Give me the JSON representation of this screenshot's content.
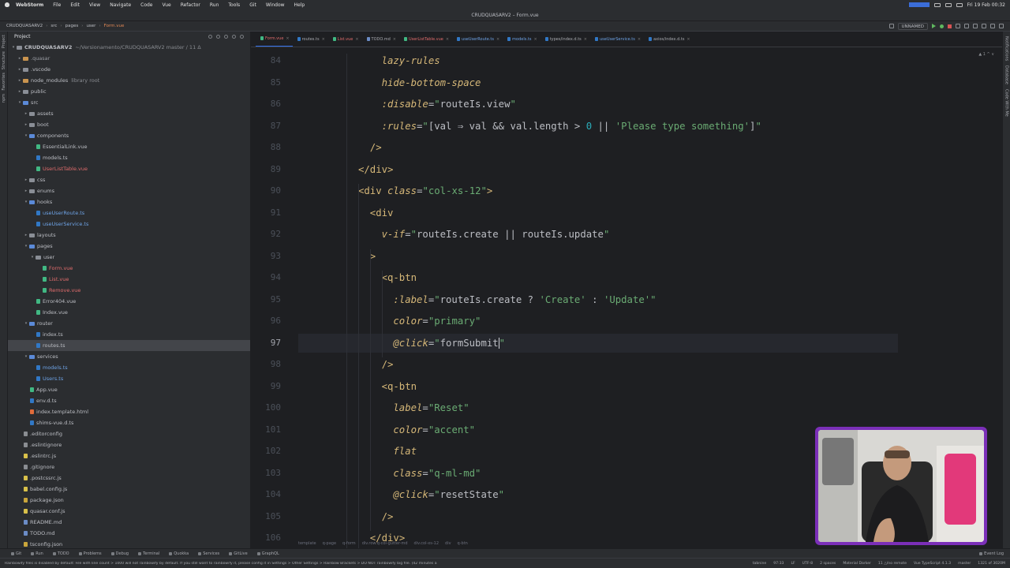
{
  "menubar": {
    "app_name": "WebStorm",
    "items": [
      "File",
      "Edit",
      "View",
      "Navigate",
      "Code",
      "Vue",
      "Refactor",
      "Run",
      "Tools",
      "Git",
      "Window",
      "Help"
    ],
    "clock": "Fri 19 Feb 00:32"
  },
  "window": {
    "title": "CRUDQUASARV2 – Form.vue"
  },
  "navbar": {
    "crumbs": [
      "CRUDQUASARV2",
      "src",
      "pages",
      "user",
      "Form.vue"
    ],
    "run_config": "UNNAMED"
  },
  "left_strip": {
    "tabs": [
      "Project",
      "Structure",
      "Favorites",
      "npm"
    ]
  },
  "project_panel": {
    "title": "Project",
    "tree": [
      {
        "depth": 0,
        "kind": "folder",
        "open": true,
        "label": "CRUDQUASARV2",
        "extra": "~/Versionamento/CRUDQUASARV2 master / 11 Δ",
        "bold": true
      },
      {
        "depth": 1,
        "kind": "folder",
        "color": "orange",
        "label": ".quasar",
        "style": "dim"
      },
      {
        "depth": 1,
        "kind": "folder",
        "label": ".vscode"
      },
      {
        "depth": 1,
        "kind": "folder",
        "color": "orange",
        "label": "node_modules",
        "extra": "library root"
      },
      {
        "depth": 1,
        "kind": "folder",
        "label": "public"
      },
      {
        "depth": 1,
        "kind": "folder",
        "open": true,
        "label": "src"
      },
      {
        "depth": 2,
        "kind": "folder",
        "label": "assets"
      },
      {
        "depth": 2,
        "kind": "folder",
        "label": "boot"
      },
      {
        "depth": 2,
        "kind": "folder",
        "open": true,
        "label": "components"
      },
      {
        "depth": 3,
        "kind": "file",
        "ftype": "vue",
        "label": "EssentialLink.vue"
      },
      {
        "depth": 3,
        "kind": "file",
        "ftype": "ts",
        "label": "models.ts"
      },
      {
        "depth": 3,
        "kind": "file",
        "ftype": "vue",
        "label": "UserListTable.vue",
        "style": "red"
      },
      {
        "depth": 2,
        "kind": "folder",
        "label": "css"
      },
      {
        "depth": 2,
        "kind": "folder",
        "label": "enums"
      },
      {
        "depth": 2,
        "kind": "folder",
        "open": true,
        "label": "hooks"
      },
      {
        "depth": 3,
        "kind": "file",
        "ftype": "ts",
        "label": "useUserRoute.ts",
        "style": "blue"
      },
      {
        "depth": 3,
        "kind": "file",
        "ftype": "ts",
        "label": "useUserService.ts",
        "style": "blue"
      },
      {
        "depth": 2,
        "kind": "folder",
        "label": "layouts"
      },
      {
        "depth": 2,
        "kind": "folder",
        "open": true,
        "label": "pages"
      },
      {
        "depth": 3,
        "kind": "folder",
        "open": true,
        "label": "user"
      },
      {
        "depth": 4,
        "kind": "file",
        "ftype": "vue",
        "label": "Form.vue",
        "style": "red"
      },
      {
        "depth": 4,
        "kind": "file",
        "ftype": "vue",
        "label": "List.vue",
        "style": "red"
      },
      {
        "depth": 4,
        "kind": "file",
        "ftype": "vue",
        "label": "Remove.vue",
        "style": "red"
      },
      {
        "depth": 3,
        "kind": "file",
        "ftype": "vue",
        "label": "Error404.vue"
      },
      {
        "depth": 3,
        "kind": "file",
        "ftype": "vue",
        "label": "Index.vue"
      },
      {
        "depth": 2,
        "kind": "folder",
        "open": true,
        "label": "router"
      },
      {
        "depth": 3,
        "kind": "file",
        "ftype": "ts",
        "label": "index.ts"
      },
      {
        "depth": 3,
        "kind": "file",
        "ftype": "ts",
        "label": "routes.ts",
        "selected": true
      },
      {
        "depth": 2,
        "kind": "folder",
        "open": true,
        "label": "services"
      },
      {
        "depth": 3,
        "kind": "file",
        "ftype": "ts",
        "label": "models.ts",
        "style": "blue"
      },
      {
        "depth": 3,
        "kind": "file",
        "ftype": "ts",
        "label": "Users.ts",
        "style": "blue"
      },
      {
        "depth": 2,
        "kind": "file",
        "ftype": "vue",
        "label": "App.vue"
      },
      {
        "depth": 2,
        "kind": "file",
        "ftype": "ts",
        "label": "env.d.ts"
      },
      {
        "depth": 2,
        "kind": "file",
        "ftype": "html",
        "label": "index.template.html"
      },
      {
        "depth": 2,
        "kind": "file",
        "ftype": "ts",
        "label": "shims-vue.d.ts"
      },
      {
        "depth": 1,
        "kind": "file",
        "ftype": "cfg",
        "label": ".editorconfig"
      },
      {
        "depth": 1,
        "kind": "file",
        "ftype": "cfg",
        "label": ".eslintignore"
      },
      {
        "depth": 1,
        "kind": "file",
        "ftype": "js",
        "label": ".eslintrc.js"
      },
      {
        "depth": 1,
        "kind": "file",
        "ftype": "cfg",
        "label": ".gitignore"
      },
      {
        "depth": 1,
        "kind": "file",
        "ftype": "js",
        "label": ".postcssrc.js"
      },
      {
        "depth": 1,
        "kind": "file",
        "ftype": "js",
        "label": "babel.config.js"
      },
      {
        "depth": 1,
        "kind": "file",
        "ftype": "json",
        "label": "package.json"
      },
      {
        "depth": 1,
        "kind": "file",
        "ftype": "js",
        "label": "quasar.conf.js"
      },
      {
        "depth": 1,
        "kind": "file",
        "ftype": "md",
        "label": "README.md"
      },
      {
        "depth": 1,
        "kind": "file",
        "ftype": "md",
        "label": "TODO.md"
      },
      {
        "depth": 1,
        "kind": "file",
        "ftype": "json",
        "label": "tsconfig.json"
      }
    ]
  },
  "editor": {
    "tabs": [
      {
        "label": "Form.vue",
        "ftype": "vue",
        "active": true,
        "style": "red"
      },
      {
        "label": "routes.ts",
        "ftype": "ts"
      },
      {
        "label": "List.vue",
        "ftype": "vue",
        "style": "red"
      },
      {
        "label": "TODO.md",
        "ftype": "md"
      },
      {
        "label": "UserListTable.vue",
        "ftype": "vue",
        "style": "red"
      },
      {
        "label": "useUserRoute.ts",
        "ftype": "ts",
        "style": "blue"
      },
      {
        "label": "models.ts",
        "ftype": "ts",
        "style": "blue"
      },
      {
        "label": "types/index.d.ts",
        "ftype": "ts"
      },
      {
        "label": "useUserService.ts",
        "ftype": "ts",
        "style": "blue"
      },
      {
        "label": "axios/index.d.ts",
        "ftype": "ts"
      }
    ],
    "inspection_badge": "▲ 1 ^ ∨",
    "current_line": 97,
    "lines": [
      {
        "n": 84,
        "indent": 7,
        "tokens": [
          [
            "attr-y",
            "lazy-rules"
          ]
        ]
      },
      {
        "n": 85,
        "indent": 7,
        "tokens": [
          [
            "attr-y",
            "hide-bottom-space"
          ]
        ]
      },
      {
        "n": 86,
        "indent": 7,
        "tokens": [
          [
            "attr-y",
            ":disable"
          ],
          [
            "punc",
            "="
          ],
          [
            "str",
            "\""
          ],
          [
            "plain",
            "routeIs.view"
          ],
          [
            "str",
            "\""
          ]
        ]
      },
      {
        "n": 87,
        "indent": 7,
        "tokens": [
          [
            "attr-y",
            ":rules"
          ],
          [
            "punc",
            "="
          ],
          [
            "str",
            "\""
          ],
          [
            "plain",
            "[val ⇒ val && val.length > "
          ],
          [
            "num",
            "0"
          ],
          [
            "plain",
            " || "
          ],
          [
            "str",
            "'Please type something'"
          ],
          [
            "plain",
            "]"
          ],
          [
            "str",
            "\""
          ]
        ]
      },
      {
        "n": 88,
        "indent": 6,
        "tokens": [
          [
            "tag",
            "/>"
          ]
        ]
      },
      {
        "n": 89,
        "indent": 5,
        "tokens": [
          [
            "tag",
            "</div>"
          ]
        ]
      },
      {
        "n": 90,
        "indent": 5,
        "tokens": [
          [
            "tag",
            "<div "
          ],
          [
            "attr",
            "class"
          ],
          [
            "punc",
            "="
          ],
          [
            "str",
            "\"col-xs-12\""
          ],
          [
            "tag",
            ">"
          ]
        ]
      },
      {
        "n": 91,
        "indent": 6,
        "tokens": [
          [
            "tag",
            "<div"
          ]
        ]
      },
      {
        "n": 92,
        "indent": 7,
        "tokens": [
          [
            "attr-y",
            "v-if"
          ],
          [
            "punc",
            "="
          ],
          [
            "str",
            "\""
          ],
          [
            "plain",
            "routeIs.create || routeIs.update"
          ],
          [
            "str",
            "\""
          ]
        ]
      },
      {
        "n": 93,
        "indent": 6,
        "tokens": [
          [
            "tag",
            ">"
          ]
        ]
      },
      {
        "n": 94,
        "indent": 7,
        "tokens": [
          [
            "tag",
            "<q-btn"
          ]
        ]
      },
      {
        "n": 95,
        "indent": 8,
        "tokens": [
          [
            "attr-y",
            ":label"
          ],
          [
            "punc",
            "="
          ],
          [
            "str",
            "\""
          ],
          [
            "plain",
            "routeIs.create ? "
          ],
          [
            "str",
            "'Create'"
          ],
          [
            "plain",
            " : "
          ],
          [
            "str",
            "'Update'"
          ],
          [
            "str",
            "\""
          ]
        ]
      },
      {
        "n": 96,
        "indent": 8,
        "tokens": [
          [
            "attr-y",
            "color"
          ],
          [
            "punc",
            "="
          ],
          [
            "str",
            "\"primary\""
          ]
        ]
      },
      {
        "n": 97,
        "indent": 8,
        "tokens": [
          [
            "attr-y",
            "@click"
          ],
          [
            "punc",
            "="
          ],
          [
            "str",
            "\""
          ],
          [
            "plain",
            "formSubmit"
          ],
          [
            "caret",
            ""
          ],
          [
            "str",
            "\""
          ]
        ]
      },
      {
        "n": 98,
        "indent": 7,
        "tokens": [
          [
            "tag",
            "/>"
          ]
        ]
      },
      {
        "n": 99,
        "indent": 7,
        "tokens": [
          [
            "tag",
            "<q-btn"
          ]
        ]
      },
      {
        "n": 100,
        "indent": 8,
        "tokens": [
          [
            "attr-y",
            "label"
          ],
          [
            "punc",
            "="
          ],
          [
            "str",
            "\"Reset\""
          ]
        ]
      },
      {
        "n": 101,
        "indent": 8,
        "tokens": [
          [
            "attr-y",
            "color"
          ],
          [
            "punc",
            "="
          ],
          [
            "str",
            "\"accent\""
          ]
        ]
      },
      {
        "n": 102,
        "indent": 8,
        "tokens": [
          [
            "attr-y",
            "flat"
          ]
        ]
      },
      {
        "n": 103,
        "indent": 8,
        "tokens": [
          [
            "attr-y",
            "class"
          ],
          [
            "punc",
            "="
          ],
          [
            "str",
            "\"q-ml-md\""
          ]
        ]
      },
      {
        "n": 104,
        "indent": 8,
        "tokens": [
          [
            "attr-y",
            "@click"
          ],
          [
            "punc",
            "="
          ],
          [
            "str",
            "\""
          ],
          [
            "plain",
            "resetState"
          ],
          [
            "str",
            "\""
          ]
        ]
      },
      {
        "n": 105,
        "indent": 7,
        "tokens": [
          [
            "tag",
            "/>"
          ]
        ]
      },
      {
        "n": 106,
        "indent": 6,
        "tokens": [
          [
            "tag",
            "</div>"
          ]
        ]
      }
    ],
    "bottom_breadcrumbs": [
      "template",
      "q-page",
      "q-form",
      "div.row.q-col-gutter-md",
      "div.col-xs-12",
      "div",
      "q-btn"
    ]
  },
  "right_strip": {
    "tabs": [
      "Notifications",
      "Database",
      "Code With Me"
    ]
  },
  "toolwindows": {
    "items": [
      "Git",
      "Run",
      "TODO",
      "Problems",
      "Debug",
      "Terminal",
      "Quokka",
      "Services",
      "GitLive",
      "GraphQL"
    ],
    "event_log": "Event Log"
  },
  "statusbar": {
    "message": "Rainbowify files is disabled by default: File with line count > 1000 will not rainbowify by default. If you still want to rainbowify it, please config it in Settings > Other Settings > Rainbow Brackets > DO NOT rainbowify big file. (42 minutes a",
    "right": [
      "tabnine",
      "97:33",
      "LF",
      "UTF-8",
      "2 spaces",
      "Material Darker",
      "11 △/no remote",
      "Vue TypeScript 4.1.3",
      "master",
      "1321 of 3020M"
    ]
  },
  "webcam": {
    "frame_color": "#7b2fb8"
  },
  "colors": {
    "accent": "#3574f0",
    "string": "#6aab73",
    "attribute": "#d5b778",
    "background": "#1e1f22",
    "panel": "#2b2d30"
  }
}
